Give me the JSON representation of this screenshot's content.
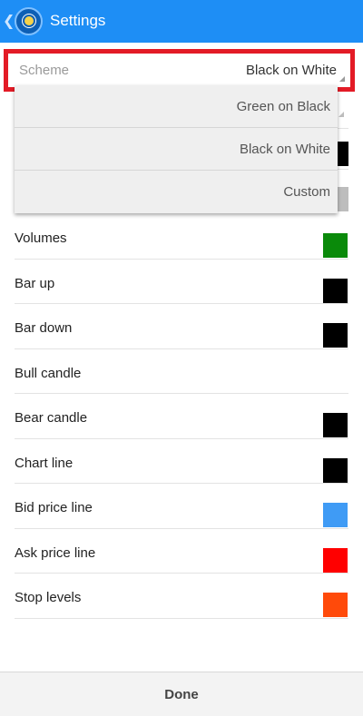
{
  "appbar": {
    "title": "Settings",
    "back_icon": "chevron-left-icon",
    "logo_icon": "app-logo-icon"
  },
  "scheme": {
    "label": "Scheme",
    "value": "Black on White",
    "highlight_color": "#e31b26"
  },
  "dropdown": {
    "options": [
      "Green on Black",
      "Black on White",
      "Custom"
    ]
  },
  "settings": [
    {
      "label": "Volumes",
      "color": "#0a8a0a"
    },
    {
      "label": "Bar up",
      "color": "#000000"
    },
    {
      "label": "Bar down",
      "color": "#000000"
    },
    {
      "label": "Bull candle",
      "color": ""
    },
    {
      "label": "Bear candle",
      "color": "#000000"
    },
    {
      "label": "Chart line",
      "color": "#000000"
    },
    {
      "label": "Bid price line",
      "color": "#3f9bf5"
    },
    {
      "label": "Ask price line",
      "color": "#ff0000"
    },
    {
      "label": "Stop levels",
      "color": "#ff4a0a"
    }
  ],
  "hidden_swatches": {
    "first_color": "#000000",
    "second_color": "#bdbdbd"
  },
  "footer": {
    "done_label": "Done"
  }
}
